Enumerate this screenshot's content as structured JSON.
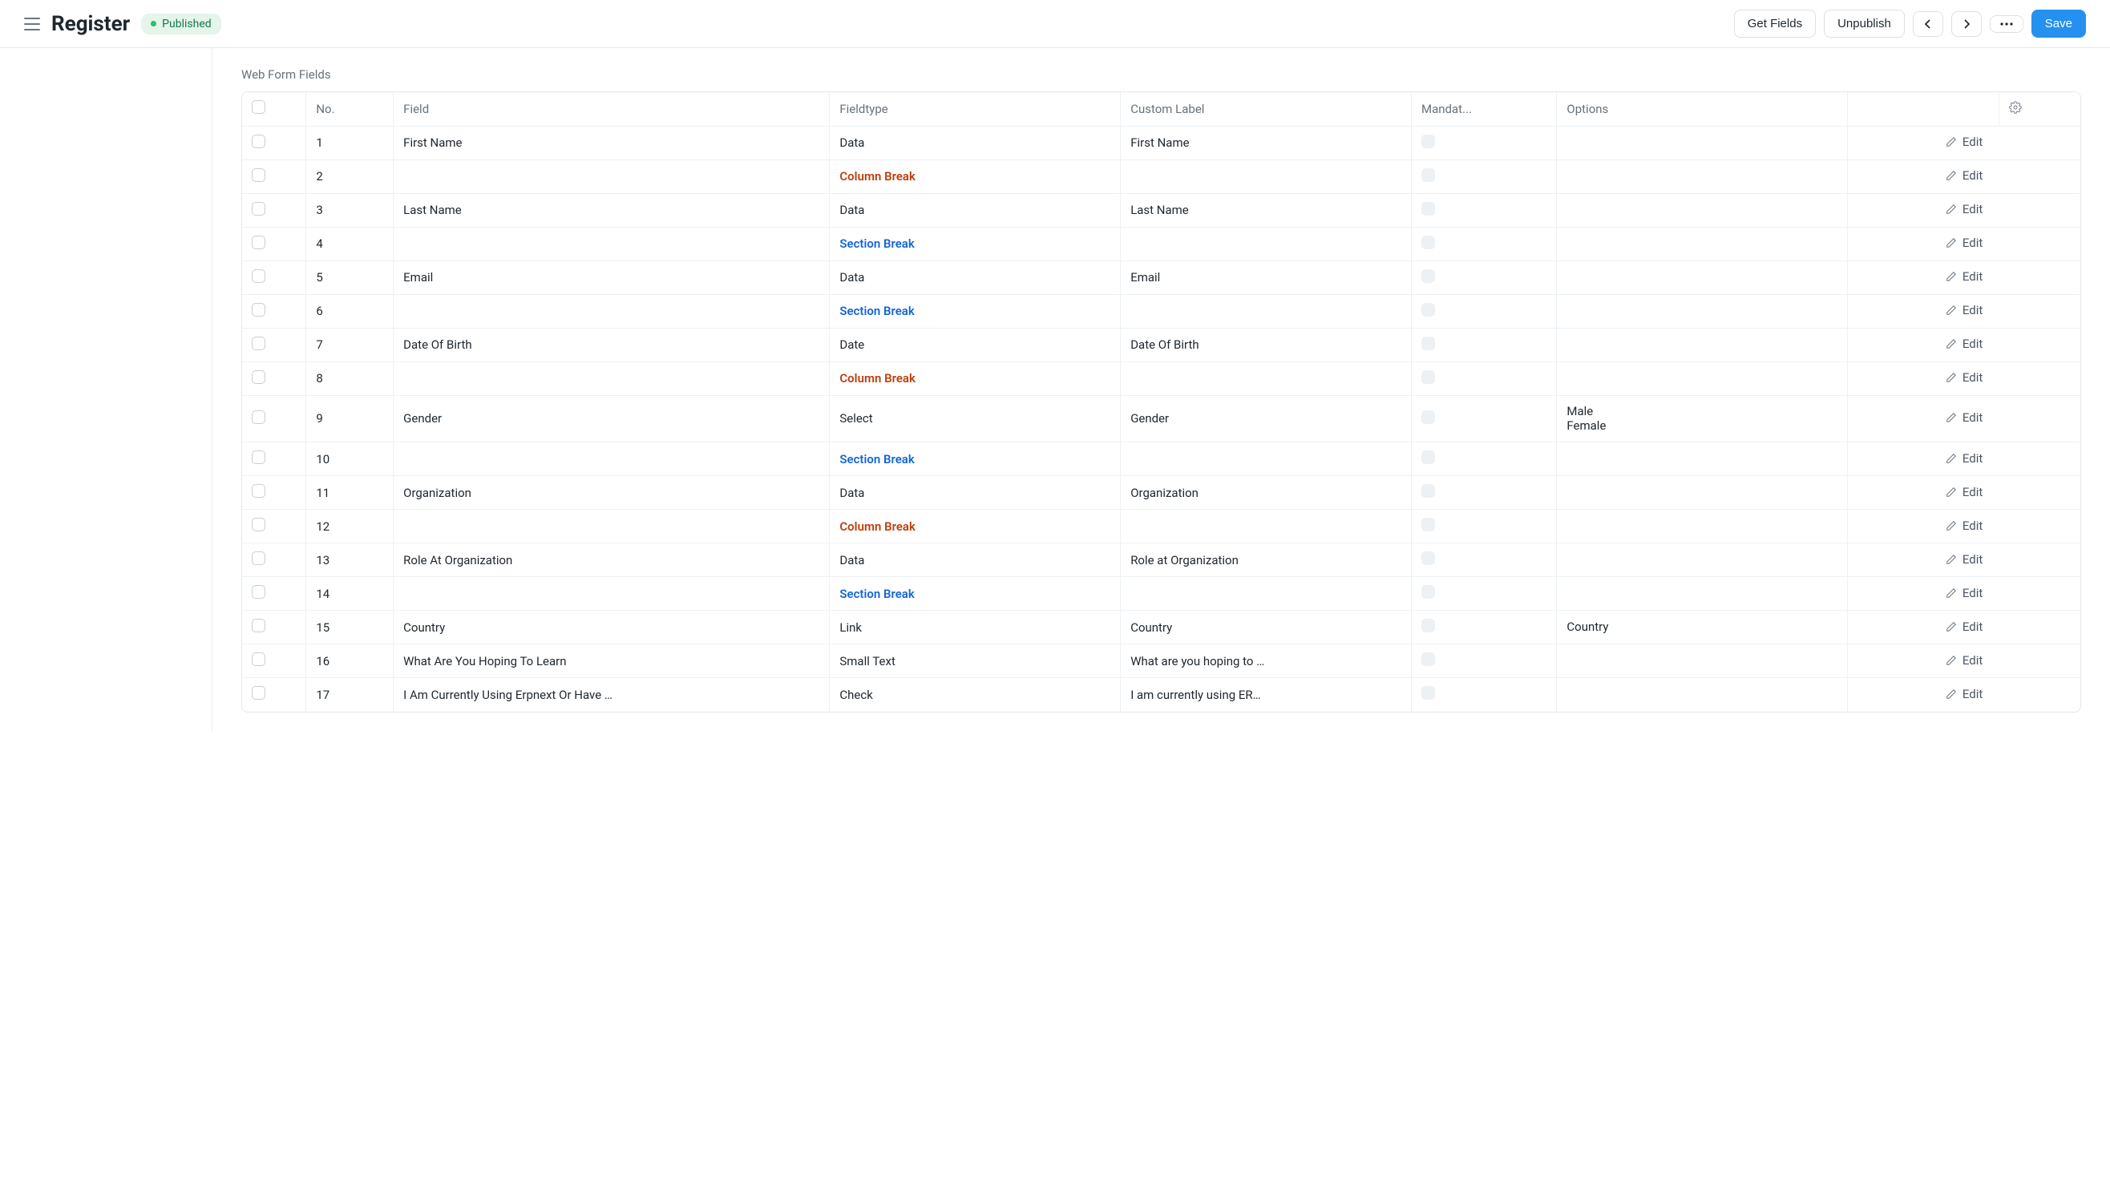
{
  "header": {
    "title": "Register",
    "status": "Published",
    "buttons": {
      "get_fields": "Get Fields",
      "unpublish": "Unpublish",
      "save": "Save"
    }
  },
  "section": {
    "label": "Web Form Fields"
  },
  "columns": {
    "no": "No.",
    "field": "Field",
    "fieldtype": "Fieldtype",
    "custom_label": "Custom Label",
    "mandatory": "Mandat...",
    "options": "Options",
    "edit": "Edit"
  },
  "rows": [
    {
      "no": "1",
      "field": "First Name",
      "fieldtype": "Data",
      "ft_class": "",
      "custom_label": "First Name",
      "options": ""
    },
    {
      "no": "2",
      "field": "",
      "fieldtype": "Column Break",
      "ft_class": "ft-column-break",
      "custom_label": "",
      "options": ""
    },
    {
      "no": "3",
      "field": "Last Name",
      "fieldtype": "Data",
      "ft_class": "",
      "custom_label": "Last Name",
      "options": ""
    },
    {
      "no": "4",
      "field": "",
      "fieldtype": "Section Break",
      "ft_class": "ft-section-break",
      "custom_label": "",
      "options": ""
    },
    {
      "no": "5",
      "field": "Email",
      "fieldtype": "Data",
      "ft_class": "",
      "custom_label": "Email",
      "options": ""
    },
    {
      "no": "6",
      "field": "",
      "fieldtype": "Section Break",
      "ft_class": "ft-section-break",
      "custom_label": "",
      "options": ""
    },
    {
      "no": "7",
      "field": "Date Of Birth",
      "fieldtype": "Date",
      "ft_class": "",
      "custom_label": "Date Of Birth",
      "options": ""
    },
    {
      "no": "8",
      "field": "",
      "fieldtype": "Column Break",
      "ft_class": "ft-column-break",
      "custom_label": "",
      "options": ""
    },
    {
      "no": "9",
      "field": "Gender",
      "fieldtype": "Select",
      "ft_class": "",
      "custom_label": "Gender",
      "options": "Male\nFemale"
    },
    {
      "no": "10",
      "field": "",
      "fieldtype": "Section Break",
      "ft_class": "ft-section-break",
      "custom_label": "",
      "options": ""
    },
    {
      "no": "11",
      "field": "Organization",
      "fieldtype": "Data",
      "ft_class": "",
      "custom_label": "Organization",
      "options": ""
    },
    {
      "no": "12",
      "field": "",
      "fieldtype": "Column Break",
      "ft_class": "ft-column-break",
      "custom_label": "",
      "options": ""
    },
    {
      "no": "13",
      "field": "Role At Organization",
      "fieldtype": "Data",
      "ft_class": "",
      "custom_label": "Role at Organization",
      "options": ""
    },
    {
      "no": "14",
      "field": "",
      "fieldtype": "Section Break",
      "ft_class": "ft-section-break",
      "custom_label": "",
      "options": ""
    },
    {
      "no": "15",
      "field": "Country",
      "fieldtype": "Link",
      "ft_class": "",
      "custom_label": "Country",
      "options": "Country"
    },
    {
      "no": "16",
      "field": "What Are You Hoping To Learn",
      "fieldtype": "Small Text",
      "ft_class": "",
      "custom_label": "What are you hoping to …",
      "options": ""
    },
    {
      "no": "17",
      "field": "I Am Currently Using Erpnext Or Have …",
      "fieldtype": "Check",
      "ft_class": "",
      "custom_label": "I am currently using ER…",
      "options": ""
    }
  ]
}
